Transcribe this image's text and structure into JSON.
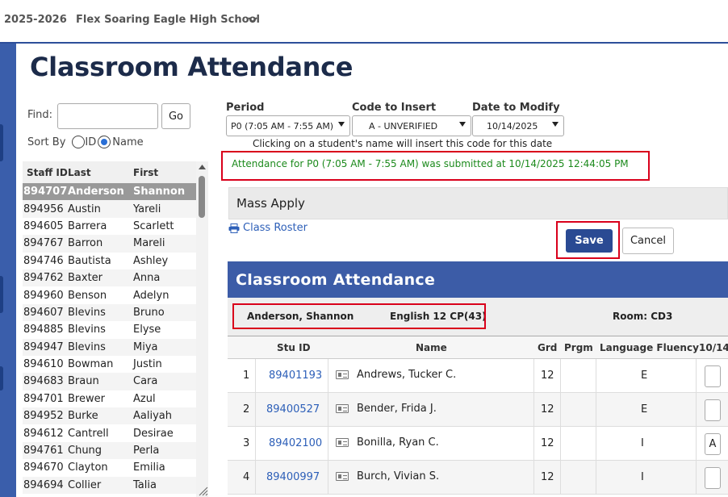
{
  "header": {
    "year": "2025-2026",
    "school": "Flex Soaring Eagle High School"
  },
  "page_title": "Classroom Attendance",
  "find": {
    "label": "Find:",
    "go_label": "Go"
  },
  "sort": {
    "label": "Sort By",
    "option_id": "ID",
    "option_name": "Name",
    "selected": "Name"
  },
  "staff_list": {
    "headers": [
      "Staff ID",
      "Last",
      "First"
    ],
    "rows": [
      [
        "894707",
        "Anderson",
        "Shannon"
      ],
      [
        "894956",
        "Austin",
        "Yareli"
      ],
      [
        "894605",
        "Barrera",
        "Scarlett"
      ],
      [
        "894767",
        "Barron",
        "Mareli"
      ],
      [
        "894746",
        "Bautista",
        "Ashley"
      ],
      [
        "894762",
        "Baxter",
        "Anna"
      ],
      [
        "894960",
        "Benson",
        "Adelyn"
      ],
      [
        "894607",
        "Blevins",
        "Bruno"
      ],
      [
        "894885",
        "Blevins",
        "Elyse"
      ],
      [
        "894947",
        "Blevins",
        "Miya"
      ],
      [
        "894610",
        "Bowman",
        "Justin"
      ],
      [
        "894683",
        "Braun",
        "Cara"
      ],
      [
        "894701",
        "Brewer",
        "Azul"
      ],
      [
        "894952",
        "Burke",
        "Aaliyah"
      ],
      [
        "894612",
        "Cantrell",
        "Desirae"
      ],
      [
        "894761",
        "Chung",
        "Perla"
      ],
      [
        "894670",
        "Clayton",
        "Emilia"
      ],
      [
        "894694",
        "Collier",
        "Talia"
      ]
    ],
    "selected_index": 0
  },
  "controls": {
    "period_label": "Period",
    "period_value": "P0 (7:05 AM - 7:55 AM)",
    "code_label": "Code to Insert",
    "code_value": "A - UNVERIFIED",
    "date_label": "Date to Modify",
    "date_value": "10/14/2025",
    "hint": "Clicking on a student's name will insert this code for this date"
  },
  "message": "Attendance for P0 (7:05 AM - 7:55 AM) was submitted at 10/14/2025 12:44:05 PM",
  "mass_apply": "Mass Apply",
  "class_roster": "Class Roster",
  "buttons": {
    "save": "Save",
    "cancel": "Cancel"
  },
  "panel": {
    "title": "Classroom Attendance",
    "teacher": "Anderson, Shannon",
    "course": "English 12 CP(43)",
    "room": "Room: CD3"
  },
  "table": {
    "headers": [
      "Stu ID",
      "Name",
      "Grd",
      "Prgm",
      "Language Fluency",
      "10/14"
    ],
    "rows": [
      {
        "num": "1",
        "id": "89401193",
        "name": "Andrews, Tucker C.",
        "grd": "12",
        "prgm": "",
        "fluency": "E",
        "code": ""
      },
      {
        "num": "2",
        "id": "89400527",
        "name": "Bender, Frida J.",
        "grd": "12",
        "prgm": "",
        "fluency": "E",
        "code": ""
      },
      {
        "num": "3",
        "id": "89402100",
        "name": "Bonilla, Ryan C.",
        "grd": "12",
        "prgm": "",
        "fluency": "I",
        "code": "A"
      },
      {
        "num": "4",
        "id": "89400997",
        "name": "Burch, Vivian S.",
        "grd": "12",
        "prgm": "",
        "fluency": "I",
        "code": ""
      }
    ]
  },
  "colors": {
    "accent": "#3c5ca7",
    "save": "#2a4a93",
    "success": "#1c8a1c",
    "highlight": "#d9001b"
  }
}
